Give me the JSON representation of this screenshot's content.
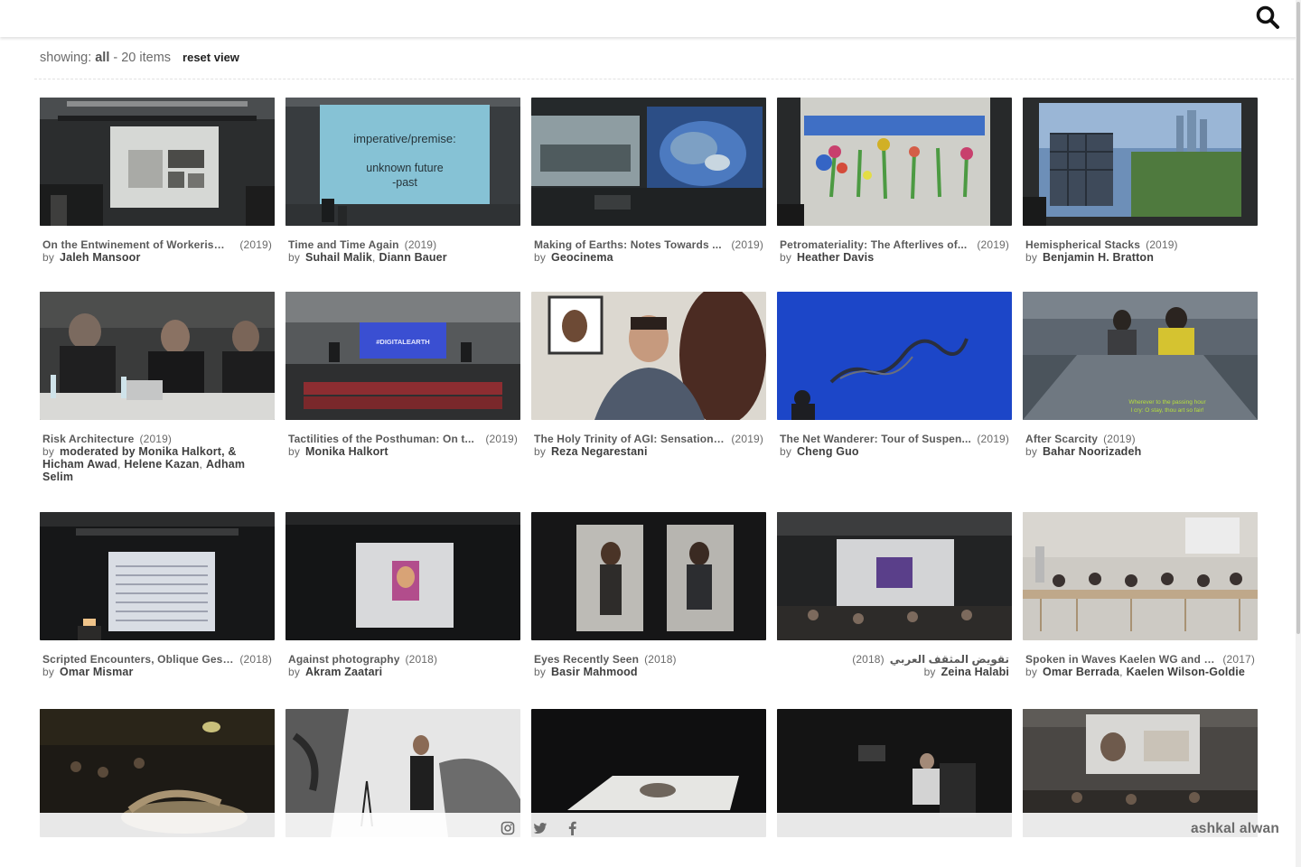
{
  "filter": {
    "showing_label": "showing:",
    "showing_value": "all",
    "count_text": "- 20 items",
    "reset_label": "reset view"
  },
  "icons": {
    "search": "search-icon",
    "instagram": "instagram-icon",
    "twitter": "twitter-icon",
    "facebook": "facebook-icon"
  },
  "footer": {
    "brand": "ashkal alwan"
  },
  "by_label": "by",
  "cards": [
    {
      "title": "On the Entwinement of Workerism ...",
      "year": "(2019)",
      "authors": [
        "Jaleh Mansoor"
      ]
    },
    {
      "title": "Time and Time Again",
      "year": "(2019)",
      "authors": [
        "Suhail Malik",
        "Diann Bauer"
      ],
      "thumb_text": [
        "imperative/premise:",
        "unknown future",
        "-past"
      ]
    },
    {
      "title": "Making of Earths: Notes Towards ...",
      "year": "(2019)",
      "authors": [
        "Geocinema"
      ]
    },
    {
      "title": "Petromateriality: The Afterlives of...",
      "year": "(2019)",
      "authors": [
        "Heather Davis"
      ]
    },
    {
      "title": "Hemispherical Stacks",
      "year": "(2019)",
      "authors": [
        "Benjamin H. Bratton"
      ]
    },
    {
      "title": "Risk Architecture",
      "year": "(2019)",
      "authors": [
        "moderated by Monika Halkort, &",
        "Hicham Awad",
        "Helene Kazan",
        "Adham Selim"
      ]
    },
    {
      "title": "Tactilities of the Posthuman: On t...",
      "year": "(2019)",
      "authors": [
        "Monika Halkort"
      ],
      "thumb_text": [
        "#DIGITALEARTH"
      ]
    },
    {
      "title": "The Holy Trinity of AGI: Sensation,...",
      "year": "(2019)",
      "authors": [
        "Reza Negarestani"
      ]
    },
    {
      "title": "The Net Wanderer: Tour of Suspen...",
      "year": "(2019)",
      "authors": [
        "Cheng Guo"
      ]
    },
    {
      "title": "After Scarcity",
      "year": "(2019)",
      "authors": [
        "Bahar Noorizadeh"
      ],
      "thumb_text": [
        "Wherever to the passing hour",
        "I cry: O stay, thou art so fair!"
      ]
    },
    {
      "title": "Scripted Encounters, Oblique Gest...",
      "year": "(2018)",
      "authors": [
        "Omar Mismar"
      ]
    },
    {
      "title": "Against photography",
      "year": "(2018)",
      "authors": [
        "Akram Zaatari"
      ]
    },
    {
      "title": "Eyes Recently Seen",
      "year": "(2018)",
      "authors": [
        "Basir Mahmood"
      ]
    },
    {
      "title": "تقويض المثقف العربي",
      "year": "(2018)",
      "authors": [
        "Zeina Halabi"
      ],
      "rtl": true
    },
    {
      "title": "Spoken in Waves Kaelen WG and O...",
      "year": "(2017)",
      "authors": [
        "Omar Berrada",
        "Kaelen Wilson-Goldie"
      ]
    },
    {
      "title": "",
      "year": "",
      "authors": []
    },
    {
      "title": "",
      "year": "",
      "authors": []
    },
    {
      "title": "",
      "year": "",
      "authors": []
    },
    {
      "title": "",
      "year": "",
      "authors": []
    },
    {
      "title": "",
      "year": "",
      "authors": []
    }
  ]
}
